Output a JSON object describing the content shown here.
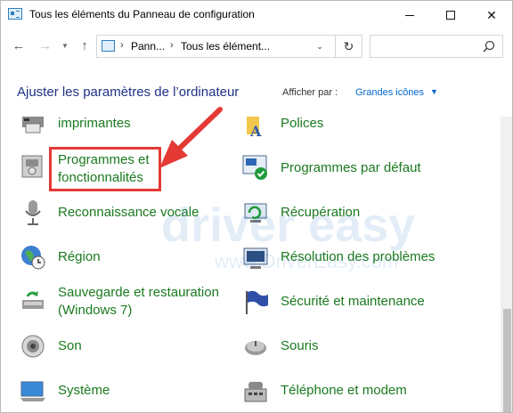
{
  "window": {
    "title": "Tous les éléments du Panneau de configuration"
  },
  "address": {
    "crumbs": [
      "Pann...",
      "Tous les élément..."
    ],
    "search_placeholder": ""
  },
  "header": {
    "title": "Ajuster les paramètres de l’ordinateur",
    "view_label": "Afficher par :",
    "view_value": "Grandes icônes"
  },
  "items": [
    {
      "label": "imprimantes",
      "icon": "printer-icon"
    },
    {
      "label": "Polices",
      "icon": "fonts-folder-icon"
    },
    {
      "label_line1": "Programmes et",
      "label_line2": "fonctionnalités",
      "icon": "programs-features-icon"
    },
    {
      "label": "Programmes par défaut",
      "icon": "default-programs-icon"
    },
    {
      "label": "Reconnaissance vocale",
      "icon": "microphone-icon"
    },
    {
      "label": "Récupération",
      "icon": "recovery-icon"
    },
    {
      "label": "Région",
      "icon": "globe-clock-icon"
    },
    {
      "label": "Résolution des problèmes",
      "icon": "troubleshoot-icon"
    },
    {
      "label_line1": "Sauvegarde et restauration",
      "label_line2": "(Windows 7)",
      "icon": "backup-restore-icon"
    },
    {
      "label": "Sécurité et maintenance",
      "icon": "security-flag-icon"
    },
    {
      "label": "Son",
      "icon": "speaker-icon"
    },
    {
      "label": "Souris",
      "icon": "mouse-icon"
    },
    {
      "label": "Système",
      "icon": "computer-icon"
    },
    {
      "label": "Téléphone et modem",
      "icon": "phone-modem-icon"
    }
  ],
  "watermark": {
    "text": "driver easy",
    "subtext": "www.DriverEasy.com"
  },
  "colors": {
    "link_green": "#1a7a1f",
    "header_blue": "#1e3287",
    "highlight_red": "#e53935"
  }
}
